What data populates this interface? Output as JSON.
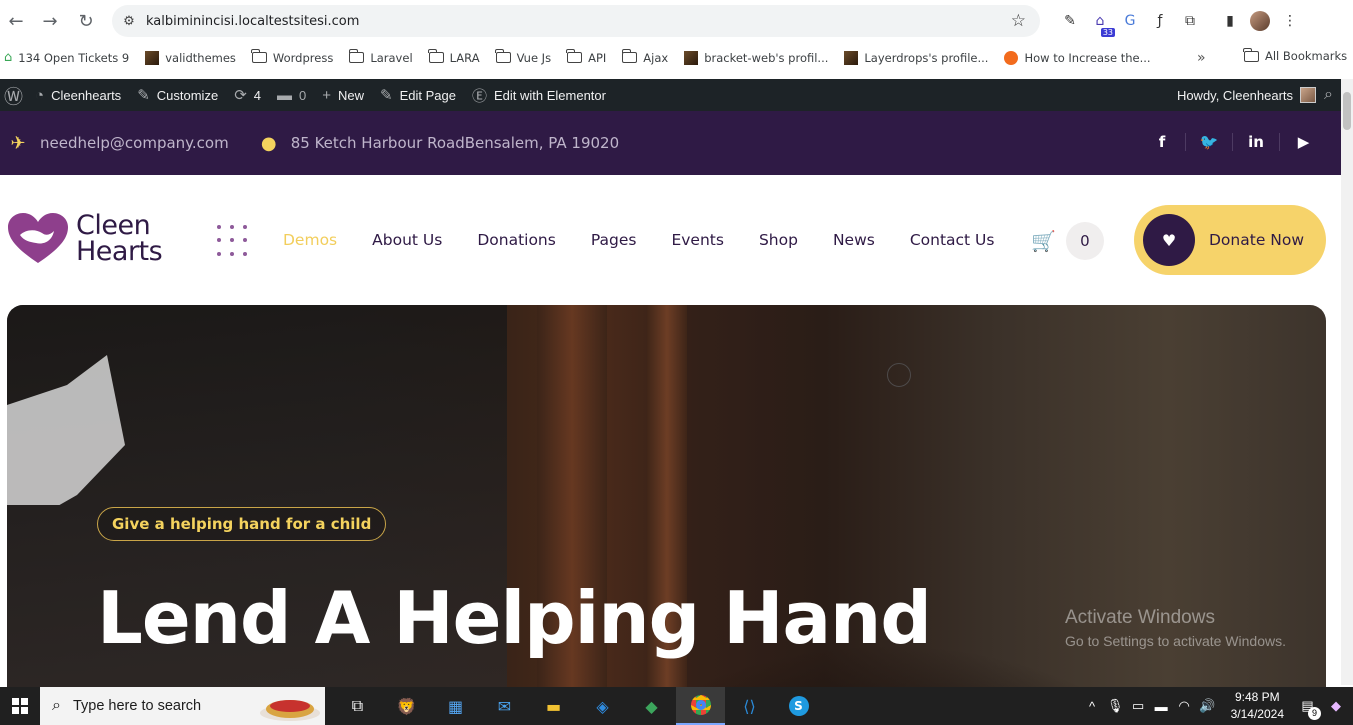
{
  "browser": {
    "url": "kalbiminincisi.localtestsitesi.com",
    "extension_badge": "33",
    "bookmarks": [
      {
        "label": "134 Open Tickets 9",
        "type": "favicon"
      },
      {
        "label": "validthemes",
        "type": "favicon"
      },
      {
        "label": "Wordpress",
        "type": "folder"
      },
      {
        "label": "Laravel",
        "type": "folder"
      },
      {
        "label": "LARA",
        "type": "folder"
      },
      {
        "label": "Vue Js",
        "type": "folder"
      },
      {
        "label": "API",
        "type": "folder"
      },
      {
        "label": "Ajax",
        "type": "folder"
      },
      {
        "label": "bracket-web's profil...",
        "type": "favicon"
      },
      {
        "label": "Layerdrops's profile...",
        "type": "favicon"
      },
      {
        "label": "How to Increase the...",
        "type": "favicon"
      }
    ],
    "more_bookmarks": "»",
    "all_bookmarks": "All Bookmarks"
  },
  "adminbar": {
    "site_name": "Cleenhearts",
    "customize": "Customize",
    "updates_count": "4",
    "comments_count": "0",
    "new": "New",
    "edit_page": "Edit Page",
    "edit_elementor": "Edit with Elementor",
    "howdy": "Howdy, Cleenhearts"
  },
  "topbar": {
    "email": "needhelp@company.com",
    "address": "85 Ketch Harbour RoadBensalem, PA 19020",
    "socials": [
      "facebook-icon",
      "twitter-icon",
      "linkedin-icon",
      "youtube-icon"
    ],
    "social_glyphs": [
      "f",
      "🐦",
      "in",
      "▶"
    ]
  },
  "header": {
    "logo_line1": "Cleen",
    "logo_line2": "Hearts",
    "menu": [
      "Demos",
      "About Us",
      "Donations",
      "Pages",
      "Events",
      "Shop",
      "News",
      "Contact Us"
    ],
    "active_menu": "Demos",
    "cart_count": "0",
    "donate_label": "Donate Now"
  },
  "hero": {
    "tagline": "Give a helping hand for a child",
    "headline": "Lend A Helping Hand"
  },
  "watermark": {
    "line1": "Activate Windows",
    "line2": "Go to Settings to activate Windows."
  },
  "taskbar": {
    "search_placeholder": "Type here to search",
    "time": "9:48 PM",
    "date": "3/14/2024",
    "notification_count": "9"
  },
  "colors": {
    "purple": "#2f1a45",
    "yellow": "#f6d36a",
    "accent_text": "#f2ce5c"
  }
}
